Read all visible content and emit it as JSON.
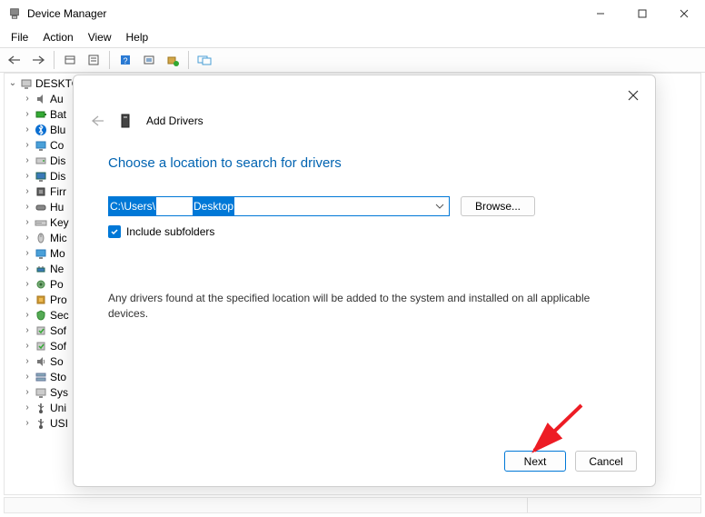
{
  "window": {
    "title": "Device Manager"
  },
  "menu": {
    "file": "File",
    "action": "Action",
    "view": "View",
    "help": "Help"
  },
  "tree": {
    "root": "DESKTO",
    "items": [
      {
        "label": "Au",
        "icon": "speaker"
      },
      {
        "label": "Bat",
        "icon": "battery"
      },
      {
        "label": "Blu",
        "icon": "bluetooth"
      },
      {
        "label": "Co",
        "icon": "monitor"
      },
      {
        "label": "Dis",
        "icon": "disk"
      },
      {
        "label": "Dis",
        "icon": "display"
      },
      {
        "label": "Firr",
        "icon": "firmware"
      },
      {
        "label": "Hu",
        "icon": "hid"
      },
      {
        "label": "Key",
        "icon": "keyboard"
      },
      {
        "label": "Mic",
        "icon": "mouse"
      },
      {
        "label": "Mo",
        "icon": "monitor"
      },
      {
        "label": "Ne",
        "icon": "network"
      },
      {
        "label": "Po",
        "icon": "ports"
      },
      {
        "label": "Pro",
        "icon": "cpu"
      },
      {
        "label": "Sec",
        "icon": "security"
      },
      {
        "label": "Sof",
        "icon": "software"
      },
      {
        "label": "Sof",
        "icon": "software"
      },
      {
        "label": "So",
        "icon": "sound"
      },
      {
        "label": "Sto",
        "icon": "storage"
      },
      {
        "label": "Sys",
        "icon": "system"
      },
      {
        "label": "Uni",
        "icon": "usb"
      },
      {
        "label": "USI",
        "icon": "usb"
      }
    ]
  },
  "dialog": {
    "title": "Add Drivers",
    "heading": "Choose a location to search for drivers",
    "path_part1": "C:\\Users\\",
    "path_part2": "Desktop",
    "browse": "Browse...",
    "checkbox_label": "Include subfolders",
    "checkbox_checked": true,
    "info": "Any drivers found at the specified location will be added to the system and installed on all applicable devices.",
    "next": "Next",
    "cancel": "Cancel"
  }
}
